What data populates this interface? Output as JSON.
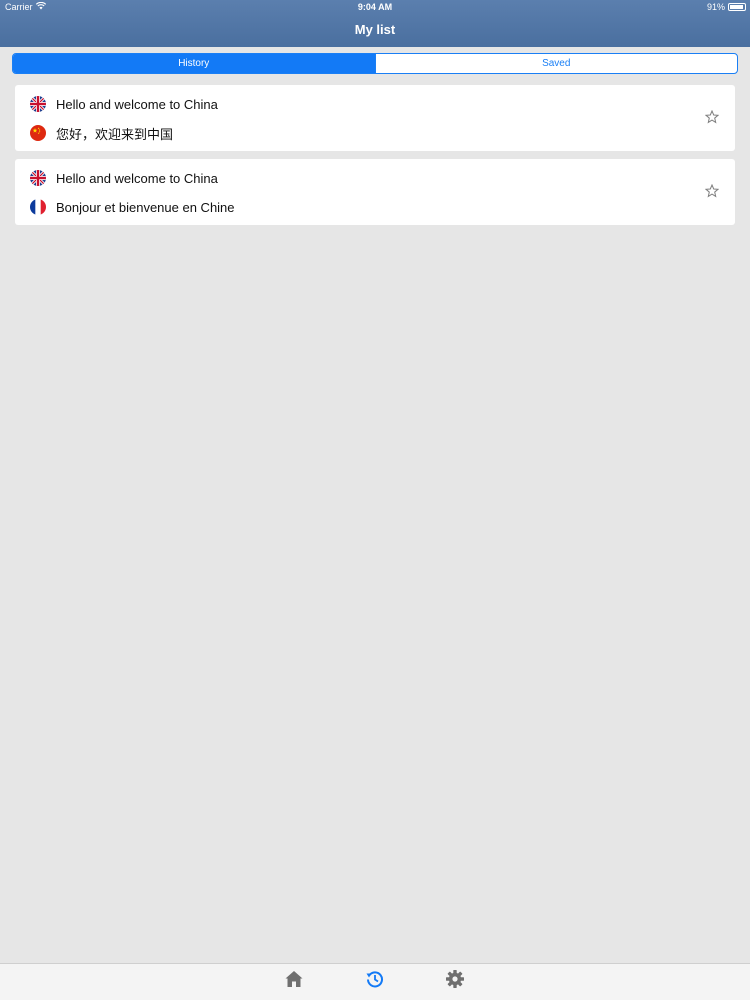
{
  "status_bar": {
    "carrier": "Carrier",
    "time": "9:04 AM",
    "battery": "91%",
    "battery_level": 0.91
  },
  "nav": {
    "title": "My list"
  },
  "segments": [
    {
      "label": "History",
      "active": true
    },
    {
      "label": "Saved",
      "active": false
    }
  ],
  "items": [
    {
      "source": {
        "flag": "uk-flag-icon",
        "text": "Hello and welcome to China"
      },
      "target": {
        "flag": "china-flag-icon",
        "text": "您好，欢迎来到中国"
      },
      "star_icon": "star-outline-icon"
    },
    {
      "source": {
        "flag": "uk-flag-icon",
        "text": "Hello and welcome to China"
      },
      "target": {
        "flag": "france-flag-icon",
        "text": "Bonjour et bienvenue en Chine"
      },
      "star_icon": "star-outline-icon"
    }
  ],
  "tabbar": {
    "tabs": [
      {
        "icon": "home-icon",
        "active": false
      },
      {
        "icon": "history-icon",
        "active": true
      },
      {
        "icon": "settings-gear-icon",
        "active": false
      }
    ]
  },
  "colors": {
    "header": "#4f74a4",
    "accent": "#137af6",
    "background": "#e6e6e6",
    "tab_inactive": "#6f6f6f"
  }
}
